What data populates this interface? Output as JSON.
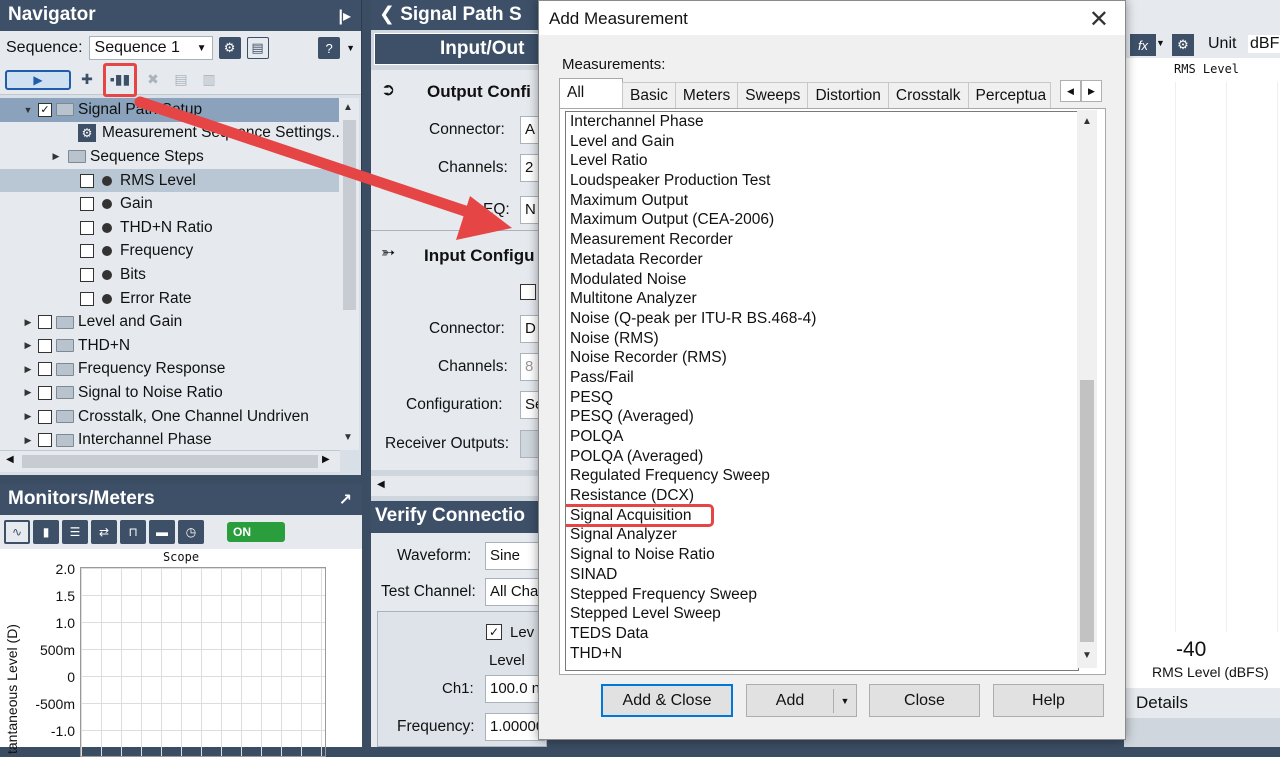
{
  "navigator": {
    "title": "Navigator",
    "sequence_label": "Sequence:",
    "sequence_value": "Sequence 1",
    "tree": [
      {
        "label": "Signal Path Setup",
        "level": 1,
        "checked": true,
        "kind": "folder",
        "expanded": true
      },
      {
        "label": "Measurement Sequence Settings..",
        "level": 2,
        "kind": "settings"
      },
      {
        "label": "Sequence Steps",
        "level": 2,
        "kind": "folder",
        "expanded": false
      },
      {
        "label": "RMS Level",
        "level": 2,
        "kind": "meter"
      },
      {
        "label": "Gain",
        "level": 2,
        "kind": "meter"
      },
      {
        "label": "THD+N Ratio",
        "level": 2,
        "kind": "meter"
      },
      {
        "label": "Frequency",
        "level": 2,
        "kind": "meter"
      },
      {
        "label": "Bits",
        "level": 2,
        "kind": "meter"
      },
      {
        "label": "Error Rate",
        "level": 2,
        "kind": "meter"
      },
      {
        "label": "Level and Gain",
        "level": 0,
        "kind": "folder"
      },
      {
        "label": "THD+N",
        "level": 0,
        "kind": "folder"
      },
      {
        "label": "Frequency Response",
        "level": 0,
        "kind": "folder"
      },
      {
        "label": "Signal to Noise Ratio",
        "level": 0,
        "kind": "folder"
      },
      {
        "label": "Crosstalk, One Channel Undriven",
        "level": 0,
        "kind": "folder"
      },
      {
        "label": "Interchannel Phase",
        "level": 0,
        "kind": "folder"
      }
    ]
  },
  "monitors": {
    "title": "Monitors/Meters",
    "on_label": "ON",
    "scope_title": "Scope",
    "y_ticks": [
      "2.0",
      "1.5",
      "1.0",
      "500m",
      "0",
      "-500m",
      "-1.0"
    ],
    "y_axis_label": "tantaneous Level (D)"
  },
  "signal_path": {
    "header": "Signal Path S",
    "tab": "Input/Out",
    "output_title": "Output Confi",
    "input_title": "Input Configu",
    "output_fields": [
      {
        "label": "Connector:",
        "value": "A"
      },
      {
        "label": "Channels:",
        "value": "2"
      },
      {
        "label": "EQ:",
        "value": "N"
      }
    ],
    "input_fields": [
      {
        "label": "Connector:",
        "value": "D"
      },
      {
        "label": "Channels:",
        "value": "8"
      },
      {
        "label": "Configuration:",
        "value": "Se"
      },
      {
        "label": "Receiver Outputs:",
        "value": ""
      }
    ],
    "verify_title": "Verify Connectio",
    "waveform_label": "Waveform:",
    "waveform_value": "Sine",
    "test_channel_label": "Test Channel:",
    "test_channel_value": "All Cha",
    "level_check": "Lev",
    "level_col": "Level",
    "ch1_label": "Ch1:",
    "ch1_value": "100.0 n",
    "frequency_label": "Frequency:",
    "frequency_value": "1.00000"
  },
  "dialog": {
    "title": "Add Measurement",
    "measurements_label": "Measurements:",
    "tabs": [
      "All",
      "Basic",
      "Meters",
      "Sweeps",
      "Distortion",
      "Crosstalk",
      "Perceptua"
    ],
    "items": [
      "Interchannel Phase",
      "Level and Gain",
      "Level Ratio",
      "Loudspeaker Production Test",
      "Maximum Output",
      "Maximum Output (CEA-2006)",
      "Measurement Recorder",
      "Metadata Recorder",
      "Modulated Noise",
      "Multitone Analyzer",
      "Noise (Q-peak per ITU-R BS.468-4)",
      "Noise (RMS)",
      "Noise Recorder (RMS)",
      "Pass/Fail",
      "PESQ",
      "PESQ (Averaged)",
      "POLQA",
      "POLQA (Averaged)",
      "Regulated Frequency Sweep",
      "Resistance (DCX)",
      "Signal Acquisition",
      "Signal Analyzer",
      "Signal to Noise Ratio",
      "SINAD",
      "Stepped Frequency Sweep",
      "Stepped Level Sweep",
      "TEDS Data",
      "THD+N"
    ],
    "highlighted_item": "Signal Acquisition",
    "buttons": {
      "add_close": "Add & Close",
      "add": "Add",
      "close": "Close",
      "help": "Help"
    }
  },
  "right_panel": {
    "unit_label": "Unit",
    "unit_value": "dBF",
    "chart_title": "RMS Level",
    "value": "-40",
    "value_label": "RMS Level (dBFS)",
    "details": "Details"
  },
  "colors": {
    "panel_header": "#3d5068",
    "highlight_red": "#e64545",
    "accent_blue": "#0078d7"
  }
}
